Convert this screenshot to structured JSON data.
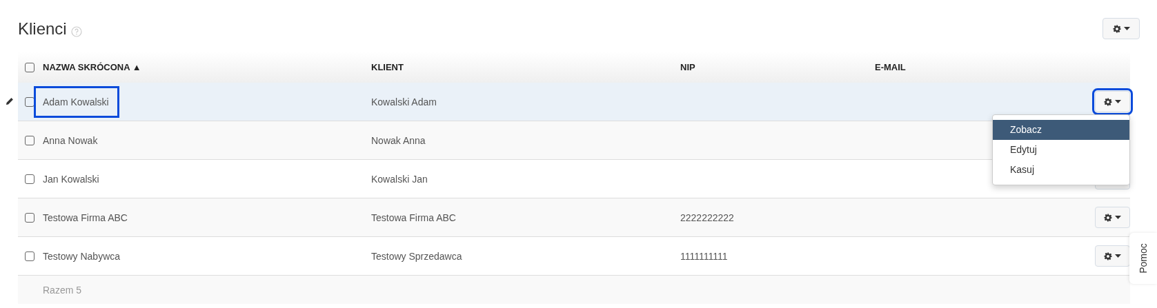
{
  "page": {
    "title": "Klienci"
  },
  "table": {
    "columns": [
      {
        "label": "NAZWA SKRÓCONA ▲"
      },
      {
        "label": "KLIENT"
      },
      {
        "label": "NIP"
      },
      {
        "label": "E-MAIL"
      }
    ],
    "select_all": {
      "checked": false
    },
    "rows": [
      {
        "name": "Adam Kowalski",
        "client": "Kowalski Adam",
        "checked": false,
        "hovered": true,
        "highlighted": true,
        "menu": [
          {
            "label": "Zobacz",
            "selected": true
          },
          {
            "label": "Edytuj",
            "selected": false
          },
          {
            "label": "Kasuj",
            "selected": false
          }
        ]
      },
      {
        "name": "Anna Nowak",
        "client": "Nowak Anna",
        "checked": false,
        "hovered": false,
        "highlighted": false
      },
      {
        "name": "Jan Kowalski",
        "client": "Kowalski Jan",
        "checked": false,
        "hovered": false,
        "highlighted": false
      },
      {
        "name": "Testowa Firma ABC",
        "client": "Testowa Firma ABC",
        "nip": "2222222222",
        "checked": false,
        "hovered": false,
        "highlighted": false
      },
      {
        "name": "Testowy Nabywca",
        "client": "Testowy Sprzedawca",
        "nip": "1111111111",
        "checked": false,
        "hovered": false,
        "highlighted": false
      }
    ],
    "footer": "Razem 5"
  },
  "help_tab": {
    "label": "Pomoc"
  }
}
